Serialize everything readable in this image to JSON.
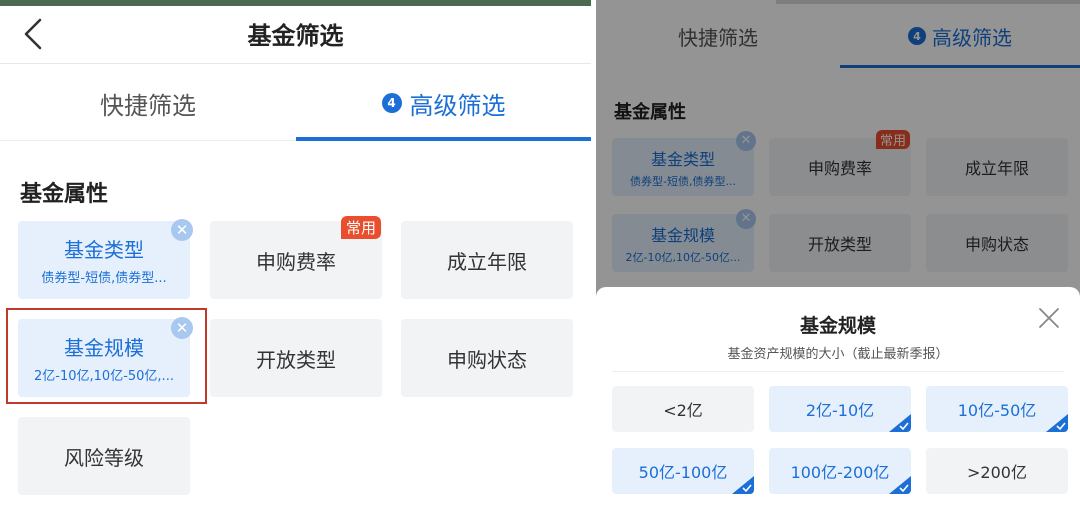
{
  "left": {
    "title": "基金筛选",
    "tabs": {
      "quick": "快捷筛选",
      "adv_count": "4",
      "adv": "高级筛选"
    },
    "section_title": "基金属性",
    "cards": {
      "fund_type": {
        "label": "基金类型",
        "sub": "债券型-短债,债券型..."
      },
      "purchase_fee": {
        "label": "申购费率",
        "tag": "常用"
      },
      "established": {
        "label": "成立年限"
      },
      "fund_size": {
        "label": "基金规模",
        "sub": "2亿-10亿,10亿-50亿,..."
      },
      "open_type": {
        "label": "开放类型"
      },
      "purchase_status": {
        "label": "申购状态"
      },
      "risk_level": {
        "label": "风险等级"
      }
    },
    "close_glyph": "✕"
  },
  "right": {
    "tabs": {
      "quick": "快捷筛选",
      "adv_count": "4",
      "adv": "高级筛选"
    },
    "section_title": "基金属性",
    "cards": {
      "fund_type": {
        "label": "基金类型",
        "sub": "债券型-短债,债券型..."
      },
      "purchase_fee": {
        "label": "申购费率",
        "tag": "常用"
      },
      "established": {
        "label": "成立年限"
      },
      "fund_size": {
        "label": "基金规模",
        "sub": "2亿-10亿,10亿-50亿..."
      },
      "open_type": {
        "label": "开放类型"
      },
      "purchase_status": {
        "label": "申购状态"
      }
    },
    "close_glyph": "✕",
    "sheet": {
      "title": "基金规模",
      "subtitle": "基金资产规模的大小（截止最新季报）",
      "options": [
        {
          "label": "<2亿",
          "selected": false
        },
        {
          "label": "2亿-10亿",
          "selected": true
        },
        {
          "label": "10亿-50亿",
          "selected": true
        },
        {
          "label": "50亿-100亿",
          "selected": true
        },
        {
          "label": "100亿-200亿",
          "selected": true
        },
        {
          "label": ">200亿",
          "selected": false
        }
      ]
    }
  },
  "colors": {
    "accent": "#1b6fd6",
    "selected_bg": "#e6f0fc",
    "card_bg": "#f2f3f5",
    "tag_red": "#e94f2e",
    "highlight_box": "#c0392b"
  },
  "icons": {
    "back": "chevron-left-icon",
    "card_remove": "close-icon",
    "sheet_close": "close-icon",
    "option_selected": "check-corner-icon"
  }
}
